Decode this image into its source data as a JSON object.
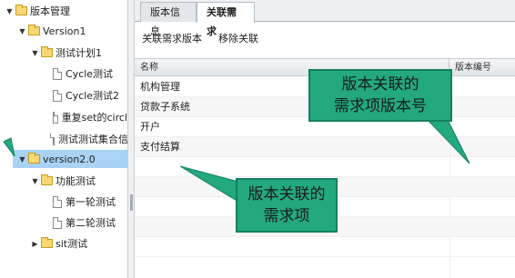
{
  "tree": {
    "items": [
      {
        "label": "版本管理",
        "type": "folder",
        "toggle": "▼"
      },
      {
        "label": "Version1",
        "type": "folder",
        "toggle": "▼"
      },
      {
        "label": "测试计划1",
        "type": "folder",
        "toggle": "▼"
      },
      {
        "label": "Cycle测试",
        "type": "file"
      },
      {
        "label": "Cycle测试2",
        "type": "file"
      },
      {
        "label": "重复set的circl",
        "type": "file"
      },
      {
        "label": "测试测试集合信",
        "type": "file"
      },
      {
        "label": "version2.0",
        "type": "folder",
        "toggle": "▼",
        "selected": true
      },
      {
        "label": "功能测试",
        "type": "folder",
        "toggle": "▼"
      },
      {
        "label": "第一轮测试",
        "type": "file"
      },
      {
        "label": "第二轮测试",
        "type": "file"
      },
      {
        "label": "sit测试",
        "type": "folder",
        "toggle": "▶"
      }
    ]
  },
  "tabs": [
    {
      "label": "版本信息",
      "active": false
    },
    {
      "label": "关联需求",
      "active": true
    }
  ],
  "toolbar": {
    "link_label": "关联需求版本",
    "remove_label": "移除关联"
  },
  "grid": {
    "columns": [
      "名称",
      "版本编号"
    ],
    "rows": [
      {
        "name": "机构管理",
        "version": ""
      },
      {
        "name": "贷款子系统",
        "version": ""
      },
      {
        "name": "开户",
        "version": ""
      },
      {
        "name": "支付结算",
        "version": ""
      }
    ]
  },
  "annotations": {
    "callout1": {
      "line1": "版本关联的",
      "line2": "需求项版本号"
    },
    "callout2": {
      "line1": "版本关联的",
      "line2": "需求项"
    },
    "color": "#23a87f"
  },
  "colors": {
    "selected_row": "#a9d3f5",
    "folder": "#f7d873",
    "callout": "#23a87f"
  }
}
